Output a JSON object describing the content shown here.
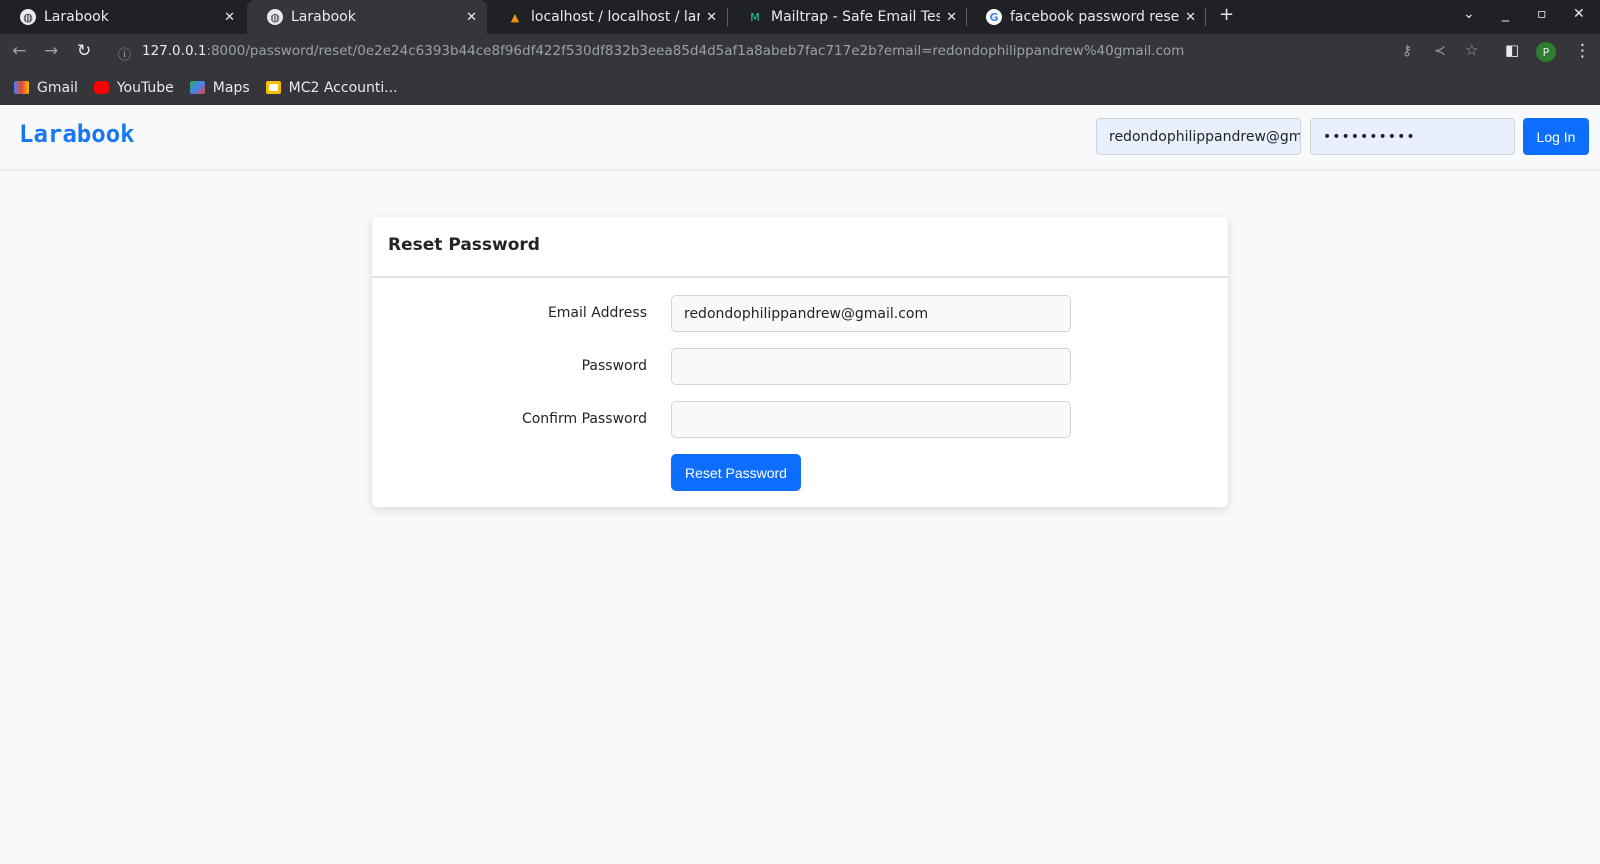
{
  "browser": {
    "tabs": [
      {
        "title": "Larabook",
        "icon": "globe-icon",
        "active": false
      },
      {
        "title": "Larabook",
        "icon": "globe-icon",
        "active": true
      },
      {
        "title": "localhost / localhost / lara",
        "icon": "phpmyadmin-icon",
        "active": false
      },
      {
        "title": "Mailtrap - Safe Email Testi",
        "icon": "mailtrap-icon",
        "active": false
      },
      {
        "title": "facebook password reset",
        "icon": "google-icon",
        "active": false
      }
    ],
    "url_host": "127.0.0.1",
    "url_rest": ":8000/password/reset/0e2e24c6393b44ce8f96df422f530df832b3eea85d4d5af1a8abeb7fac717e2b?email=redondophilippandrew%40gmail.com",
    "profile_initial": "P",
    "bookmarks": [
      {
        "label": "Gmail"
      },
      {
        "label": "YouTube"
      },
      {
        "label": "Maps"
      },
      {
        "label": "MC2 Accounti..."
      }
    ]
  },
  "navbar": {
    "brand": "Larabook",
    "email_value": "redondophilippandrew@gmail.com",
    "password_value": "••••••••••",
    "login_label": "Log In"
  },
  "card": {
    "title": "Reset Password",
    "email_label": "Email Address",
    "email_value": "redondophilippandrew@gmail.com",
    "password_label": "Password",
    "password_value": "",
    "confirm_label": "Confirm Password",
    "confirm_value": "",
    "submit_label": "Reset Password"
  },
  "colors": {
    "brand": "#1877f2",
    "primary": "#0d6efd"
  }
}
